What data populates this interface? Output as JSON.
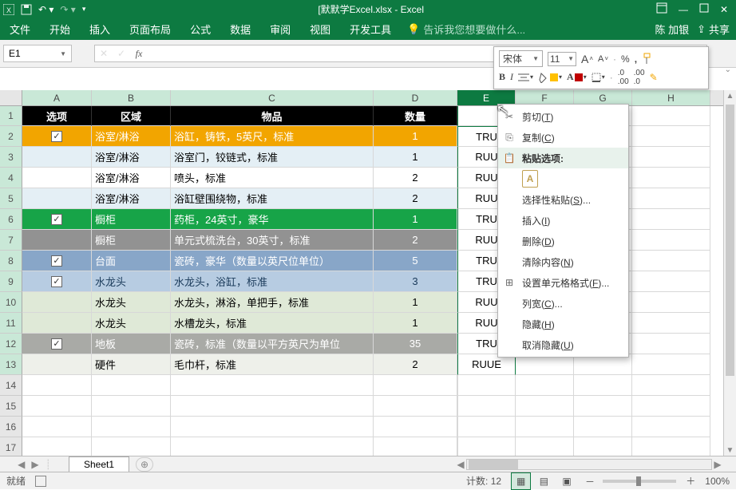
{
  "app": {
    "title": "[默默学Excel.xlsx - Excel",
    "user": "陈 加银",
    "share": "共享"
  },
  "menu": {
    "file": "文件",
    "home": "开始",
    "insert": "插入",
    "layout": "页面布局",
    "formula": "公式",
    "data": "数据",
    "review": "审阅",
    "view": "视图",
    "dev": "开发工具",
    "tell": "告诉我您想要做什么..."
  },
  "namebox": "E1",
  "mini": {
    "font": "宋体",
    "size": "11",
    "bold": "B",
    "italic": "I",
    "incA": "A",
    "decA": "A",
    "pct": "%",
    "comma": ","
  },
  "headers": {
    "A": "选项",
    "B": "区域",
    "C": "物品",
    "D": "数量"
  },
  "cols": [
    "A",
    "B",
    "C",
    "D",
    "E",
    "F",
    "G",
    "H"
  ],
  "rows": [
    {
      "chk": true,
      "B": "浴室/淋浴",
      "C": "浴缸，铸铁，5英尺，标准",
      "D": "1",
      "E": "TRU"
    },
    {
      "chk": false,
      "B": "浴室/淋浴",
      "C": "浴室门，铰链式，标准",
      "D": "1",
      "E": "RUU"
    },
    {
      "chk": false,
      "B": "浴室/淋浴",
      "C": "喷头，标准",
      "D": "2",
      "E": "RUU"
    },
    {
      "chk": false,
      "B": "浴室/淋浴",
      "C": "浴缸壁围绕物，标准",
      "D": "2",
      "E": "RUU"
    },
    {
      "chk": true,
      "B": "橱柜",
      "C": "药柜，24英寸，豪华",
      "D": "1",
      "E": "TRU"
    },
    {
      "chk": false,
      "B": "橱柜",
      "C": "单元式梳洗台，30英寸，标准",
      "D": "2",
      "E": "RUU"
    },
    {
      "chk": true,
      "B": "台面",
      "C": "瓷砖，豪华（数量以英尺位单位）",
      "D": "5",
      "E": "TRU"
    },
    {
      "chk": true,
      "B": "水龙头",
      "C": "水龙头，浴缸，标准",
      "D": "3",
      "E": "TRU"
    },
    {
      "chk": false,
      "B": "水龙头",
      "C": "水龙头，淋浴，单把手，标准",
      "D": "1",
      "E": "RUU"
    },
    {
      "chk": false,
      "B": "水龙头",
      "C": "水槽龙头，标准",
      "D": "1",
      "E": "RUU"
    },
    {
      "chk": true,
      "B": "地板",
      "C": "瓷砖，标准（数量以平方英尺为单位",
      "D": "35",
      "E": "TRU"
    },
    {
      "chk": false,
      "B": "硬件",
      "C": "毛巾杆，标准",
      "D": "2",
      "E": "RUUE"
    }
  ],
  "ctx": {
    "cut": "剪切",
    "cut_u": "T",
    "copy": "复制",
    "copy_u": "C",
    "paste_opts": "粘贴选项:",
    "pspecial": "选择性粘贴",
    "pspecial_u": "S",
    "insert": "插入",
    "insert_u": "I",
    "delete": "删除",
    "delete_u": "D",
    "clear": "清除内容",
    "clear_u": "N",
    "format": "设置单元格格式",
    "format_u": "F",
    "colw": "列宽",
    "colw_u": "C",
    "hide": "隐藏",
    "hide_u": "H",
    "unhide": "取消隐藏",
    "unhide_u": "U",
    "clip_letter": "A"
  },
  "tabs": {
    "sheet": "Sheet1"
  },
  "status": {
    "ready": "就绪",
    "count_label": "计数:",
    "count_val": "12",
    "zoom": "100%"
  }
}
